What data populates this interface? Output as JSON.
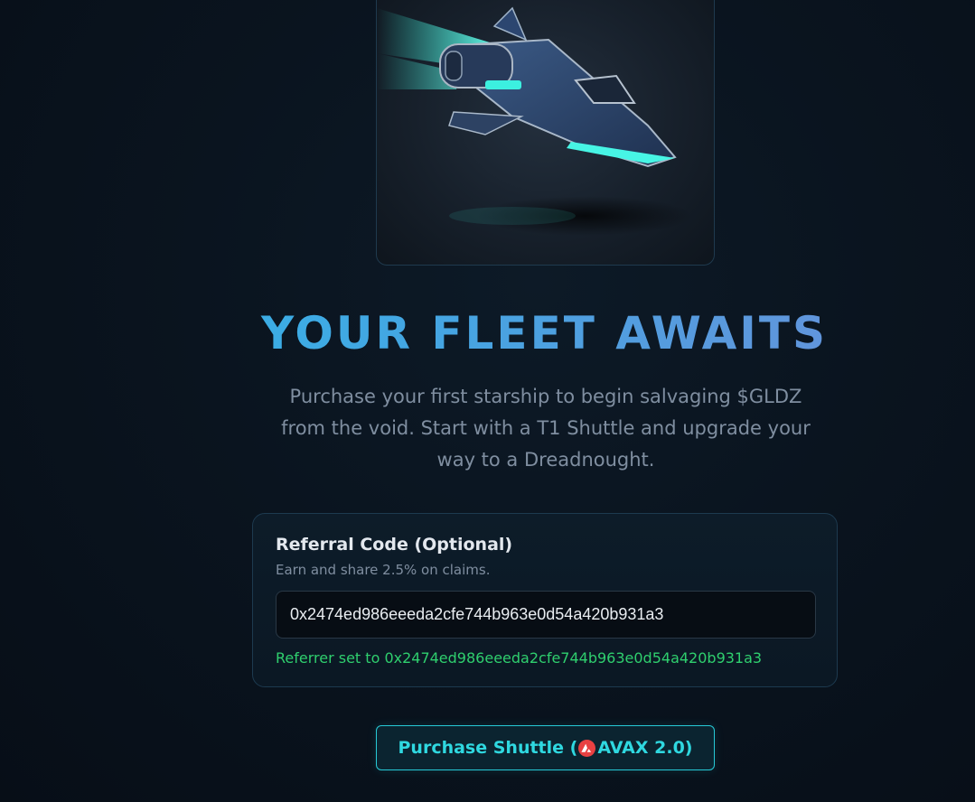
{
  "hero": {
    "image_name": "starship-shuttle-illustration"
  },
  "title": "YOUR FLEET AWAITS",
  "subtitle": "Purchase your first starship to begin salvaging $GLDZ from the void. Start with a T1 Shuttle and upgrade your way to a Dreadnought.",
  "referral": {
    "title": "Referral Code (Optional)",
    "help": "Earn and share 2.5% on claims.",
    "input_value": "0x2474ed986eeeda2cfe744b963e0d54a420b931a3",
    "status": "Referrer set to 0x2474ed986eeeda2cfe744b963e0d54a420b931a3"
  },
  "purchase_button": {
    "prefix": "Purchase Shuttle (",
    "icon": "avax-icon",
    "suffix": "AVAX 2.0)"
  },
  "colors": {
    "accent_cyan": "#2fd8e0",
    "title_gradient_start": "#2db8e8",
    "title_gradient_end": "#6b8fd9",
    "success_green": "#2fcf6e",
    "avax_red": "#e84142",
    "background": "#0a141f"
  }
}
